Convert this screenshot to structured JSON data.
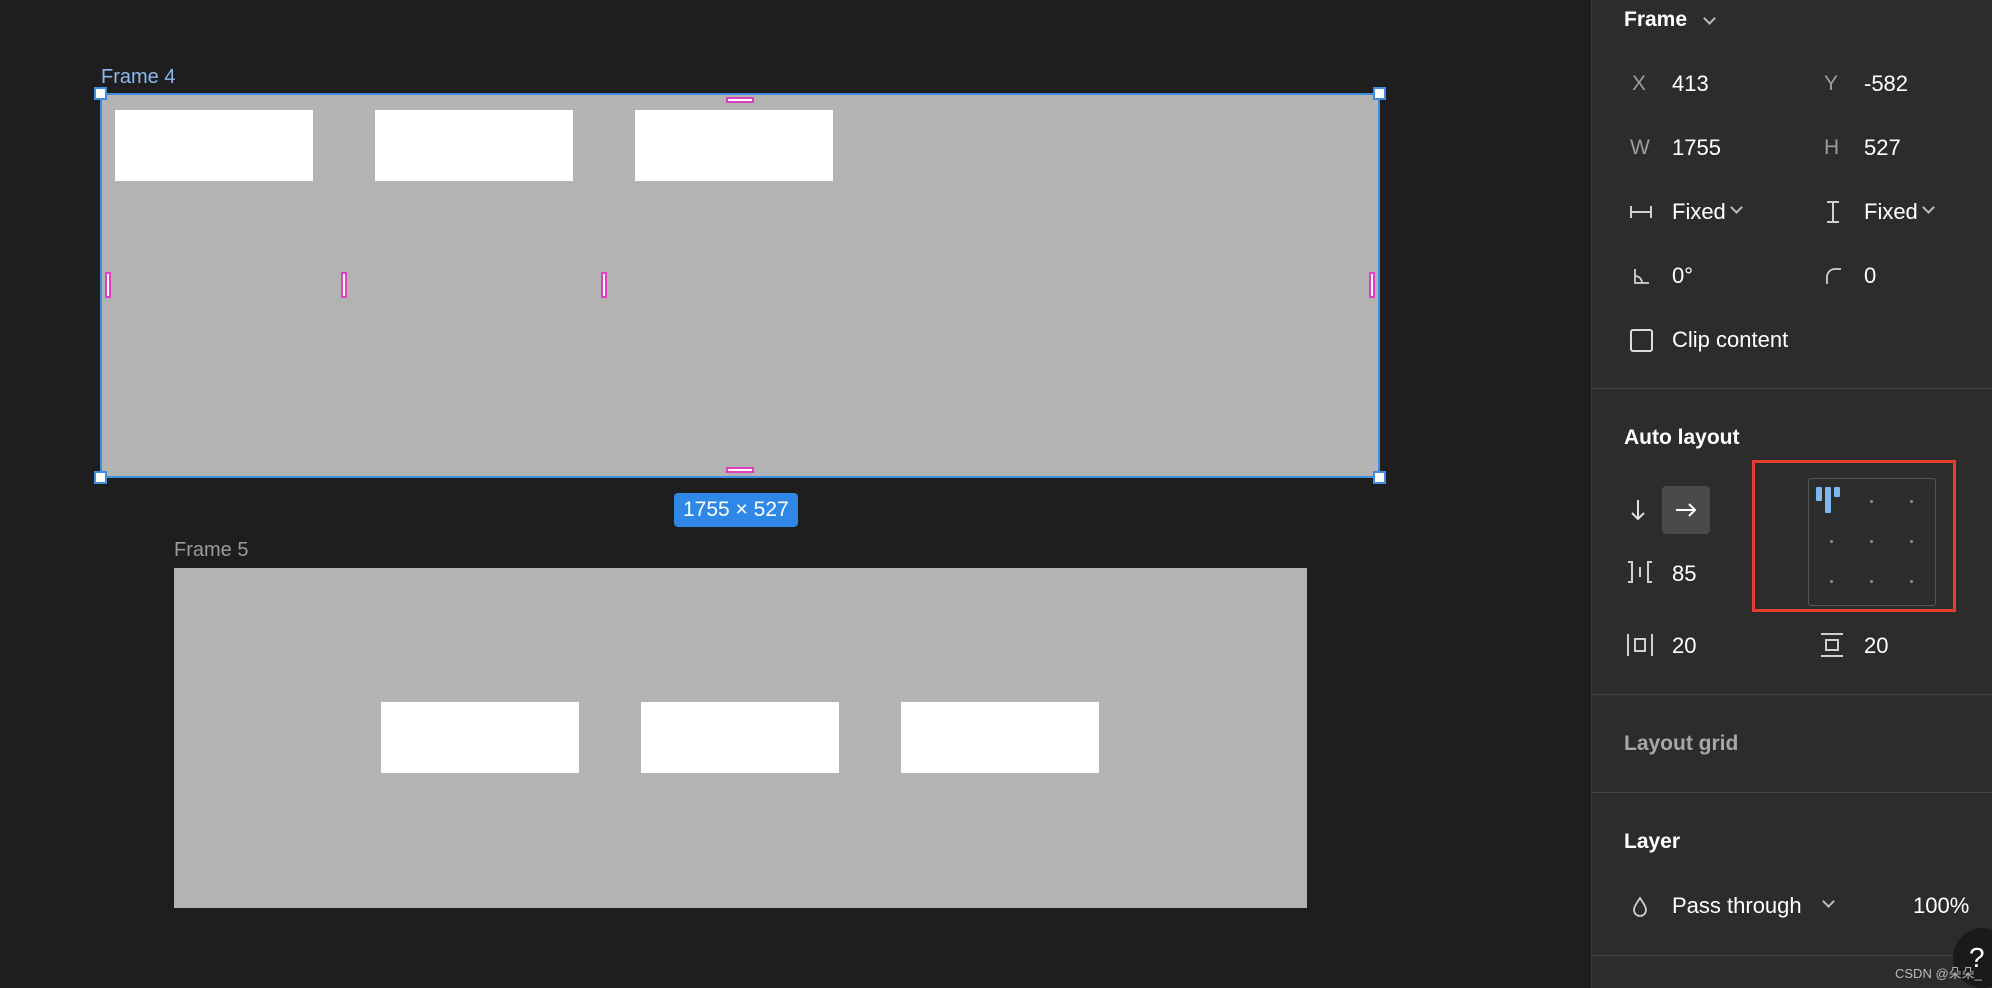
{
  "canvas": {
    "frame4": {
      "label": "Frame 4",
      "size_badge": "1755 × 527"
    },
    "frame5": {
      "label": "Frame 5"
    }
  },
  "panel": {
    "frame_section": {
      "title": "Frame",
      "x_label": "X",
      "x_value": "413",
      "y_label": "Y",
      "y_value": "-582",
      "w_label": "W",
      "w_value": "1755",
      "h_label": "H",
      "h_value": "527",
      "width_mode": "Fixed",
      "height_mode": "Fixed",
      "rotation": "0°",
      "corner_radius": "0",
      "clip_content_label": "Clip content",
      "clip_content_checked": false
    },
    "auto_layout": {
      "title": "Auto layout",
      "direction_selected": "horizontal",
      "gap": "85",
      "padding_horizontal": "20",
      "padding_vertical": "20",
      "alignment": "top-left"
    },
    "layout_grid": {
      "title": "Layout grid"
    },
    "layer": {
      "title": "Layer",
      "blend_mode": "Pass through",
      "opacity": "100%"
    }
  },
  "watermark": "CSDN @朵朵_",
  "help_label": "?",
  "colors": {
    "selection": "#3d8ee0",
    "padding_marker": "#e03fbf",
    "highlight_outline": "#e3402f",
    "alignment_active": "#7fb8ec"
  }
}
